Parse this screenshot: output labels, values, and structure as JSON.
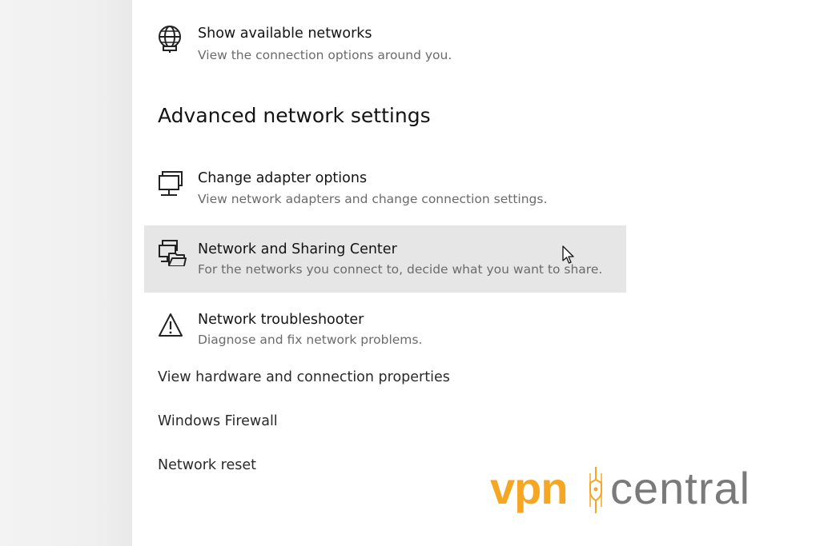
{
  "items": {
    "show_networks": {
      "title": "Show available networks",
      "desc": "View the connection options around you.",
      "icon": "globe-network-icon"
    },
    "adapter": {
      "title": "Change adapter options",
      "desc": "View network adapters and change connection settings.",
      "icon": "monitor-network-icon"
    },
    "sharing": {
      "title": "Network and Sharing Center",
      "desc": "For the networks you connect to, decide what you want to share.",
      "icon": "network-sharing-icon"
    },
    "troubleshooter": {
      "title": "Network troubleshooter",
      "desc": "Diagnose and fix network problems.",
      "icon": "warning-icon"
    }
  },
  "section_heading": "Advanced network settings",
  "links": {
    "hardware": "View hardware and connection properties",
    "firewall": "Windows Firewall",
    "reset": "Network reset"
  },
  "watermark": {
    "part1": "vpn",
    "part2": "central",
    "part1_color": "#f5a623",
    "part2_color": "#7a7a7a"
  },
  "colors": {
    "hover_background": "#e6e6e6",
    "description_text": "#6b6b6b"
  }
}
